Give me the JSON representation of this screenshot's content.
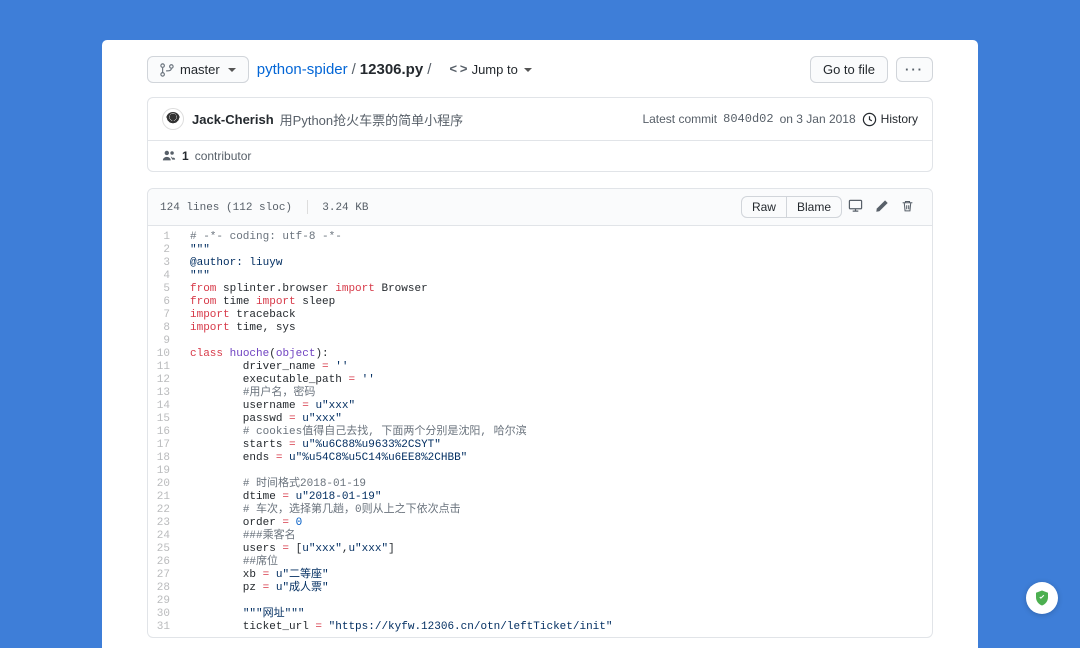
{
  "branch": {
    "name": "master"
  },
  "breadcrumb": {
    "repo": "python-spider",
    "sep": "/",
    "file": "12306.py",
    "slash2": "/"
  },
  "jumpto": {
    "label": "Jump to"
  },
  "gotofile": {
    "label": "Go to file"
  },
  "commit": {
    "author": "Jack-Cherish",
    "message": "用Python抢火车票的简单小程序",
    "meta_prefix": "Latest commit",
    "sha": "8040d02",
    "date": "on 3 Jan 2018",
    "history_label": "History"
  },
  "contributors": {
    "count": "1",
    "label": "contributor"
  },
  "fileinfo": {
    "lines": "124 lines (112 sloc)",
    "size": "3.24 KB"
  },
  "raw_label": "Raw",
  "blame_label": "Blame",
  "code_lines": [
    {
      "n": 1,
      "h": "<span class='c'># -*- coding: utf-8 -*-</span>"
    },
    {
      "n": 2,
      "h": "<span class='s'>\"\"\"</span>"
    },
    {
      "n": 3,
      "h": "<span class='s'>@author: liuyw</span>"
    },
    {
      "n": 4,
      "h": "<span class='s'>\"\"\"</span>"
    },
    {
      "n": 5,
      "h": "<span class='k'>from</span> <span class='v'>splinter.browser</span> <span class='k'>import</span> <span class='v'>Browser</span>"
    },
    {
      "n": 6,
      "h": "<span class='k'>from</span> <span class='v'>time</span> <span class='k'>import</span> <span class='v'>sleep</span>"
    },
    {
      "n": 7,
      "h": "<span class='k'>import</span> <span class='v'>traceback</span>"
    },
    {
      "n": 8,
      "h": "<span class='k'>import</span> <span class='v'>time, sys</span>"
    },
    {
      "n": 9,
      "h": ""
    },
    {
      "n": 10,
      "h": "<span class='k'>class</span> <span class='f'>huoche</span>(<span class='n'>object</span>):"
    },
    {
      "n": 11,
      "h": "        driver_name <span class='o'>=</span> <span class='s'>''</span>"
    },
    {
      "n": 12,
      "h": "        executable_path <span class='o'>=</span> <span class='s'>''</span>"
    },
    {
      "n": 13,
      "h": "        <span class='c'>#用户名，密码</span>"
    },
    {
      "n": 14,
      "h": "        username <span class='o'>=</span> <span class='s'>u\"xxx\"</span>"
    },
    {
      "n": 15,
      "h": "        passwd <span class='o'>=</span> <span class='s'>u\"xxx\"</span>"
    },
    {
      "n": 16,
      "h": "        <span class='c'># cookies值得自己去找, 下面两个分别是沈阳, 哈尔滨</span>"
    },
    {
      "n": 17,
      "h": "        starts <span class='o'>=</span> <span class='s'>u\"%u6C88%u9633%2CSYT\"</span>"
    },
    {
      "n": 18,
      "h": "        ends <span class='o'>=</span> <span class='s'>u\"%u54C8%u5C14%u6EE8%2CHBB\"</span>"
    },
    {
      "n": 19,
      "h": ""
    },
    {
      "n": 20,
      "h": "        <span class='c'># 时间格式2018-01-19</span>"
    },
    {
      "n": 21,
      "h": "        dtime <span class='o'>=</span> <span class='s'>u\"2018-01-19\"</span>"
    },
    {
      "n": 22,
      "h": "        <span class='c'># 车次，选择第几趟，0则从上之下依次点击</span>"
    },
    {
      "n": 23,
      "h": "        order <span class='o'>=</span> <span class='nm'>0</span>"
    },
    {
      "n": 24,
      "h": "        <span class='c'>###乘客名</span>"
    },
    {
      "n": 25,
      "h": "        users <span class='o'>=</span> [<span class='s'>u\"xxx\"</span>,<span class='s'>u\"xxx\"</span>]"
    },
    {
      "n": 26,
      "h": "        <span class='c'>##席位</span>"
    },
    {
      "n": 27,
      "h": "        xb <span class='o'>=</span> <span class='s'>u\"二等座\"</span>"
    },
    {
      "n": 28,
      "h": "        pz <span class='o'>=</span> <span class='s'>u\"成人票\"</span>"
    },
    {
      "n": 29,
      "h": ""
    },
    {
      "n": 30,
      "h": "        <span class='s'>\"\"\"网址\"\"\"</span>"
    },
    {
      "n": 31,
      "h": "        ticket_url <span class='o'>=</span> <span class='s'>\"https://kyfw.12306.cn/otn/leftTicket/init\"</span>"
    }
  ]
}
